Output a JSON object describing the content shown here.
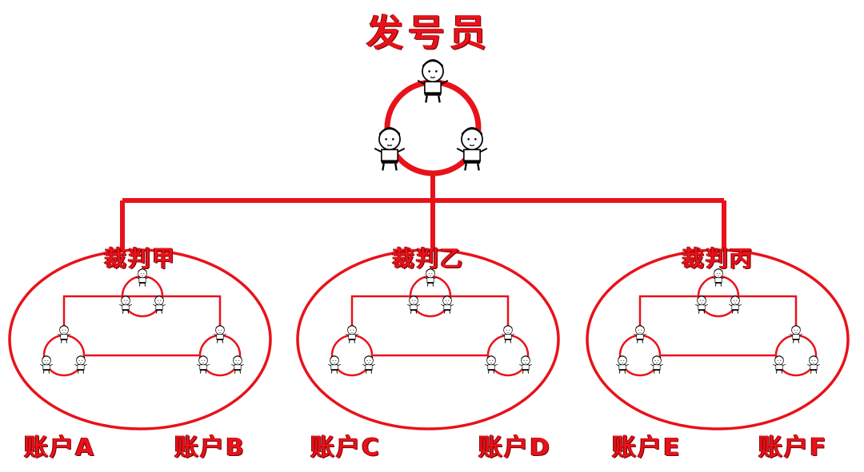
{
  "title": "发号员",
  "judges": [
    "裁判甲",
    "裁判乙",
    "裁判丙"
  ],
  "accounts": [
    "账户A",
    "账户B",
    "账户C",
    "账户D",
    "账户E",
    "账户F"
  ],
  "colors": {
    "line": "#e8121a",
    "text": "#e8121a"
  },
  "icons": {
    "node": "cartoon-figure-icon"
  }
}
